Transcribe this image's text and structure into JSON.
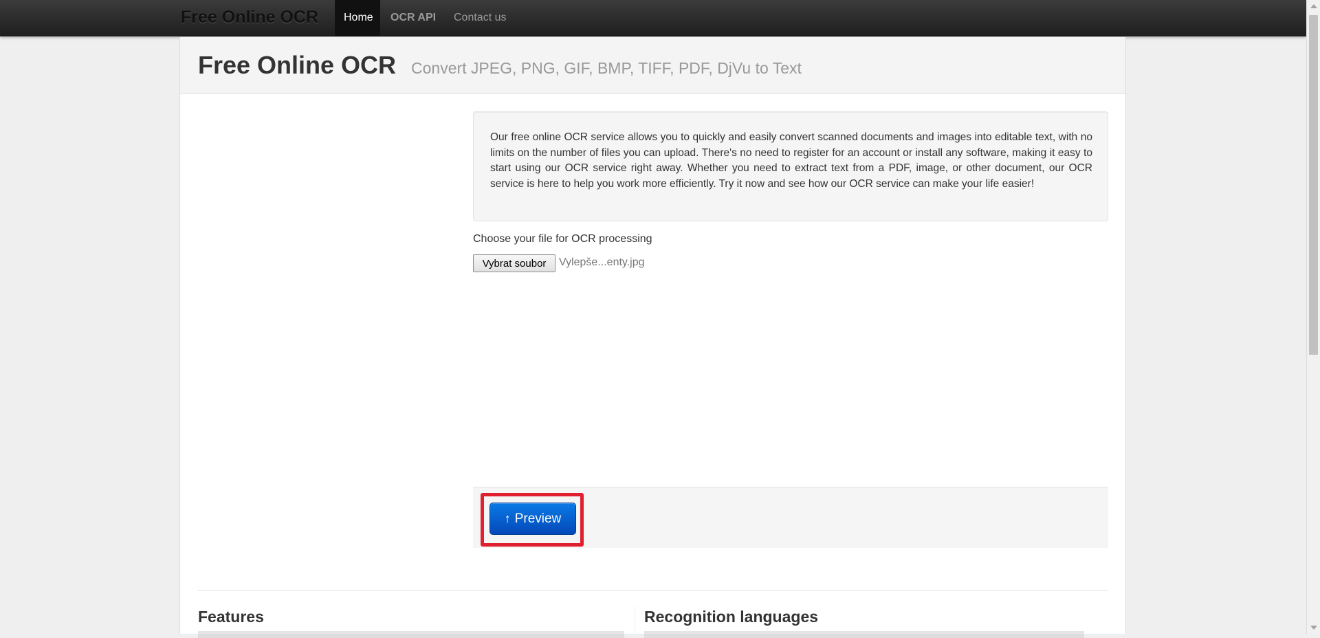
{
  "navbar": {
    "brand": "Free Online OCR",
    "items": [
      "Home",
      "OCR API",
      "Contact us"
    ]
  },
  "hero": {
    "title": "Free Online OCR",
    "subtitle": "Convert JPEG, PNG, GIF, BMP, TIFF, PDF, DjVu to Text"
  },
  "intro": {
    "text": "Our free online OCR service allows you to quickly and easily convert scanned documents and images into editable text, with no limits on the number of files you can upload. There's no need to register for an account or install any software, making it easy to start using our OCR service right away. Whether you need to extract text from a PDF, image, or other document, our OCR service is here to help you work more efficiently. Try it now and see how our OCR service can make your life easier!"
  },
  "upload": {
    "label": "Choose your file for OCR processing",
    "button": "Vybrat soubor",
    "filename": "Vylepše...enty.jpg"
  },
  "actions": {
    "preview_icon": "arrow-up-icon",
    "preview_label": "Preview",
    "highlight_color": "#e0202e"
  },
  "sections": {
    "features": "Features",
    "languages": "Recognition languages"
  }
}
